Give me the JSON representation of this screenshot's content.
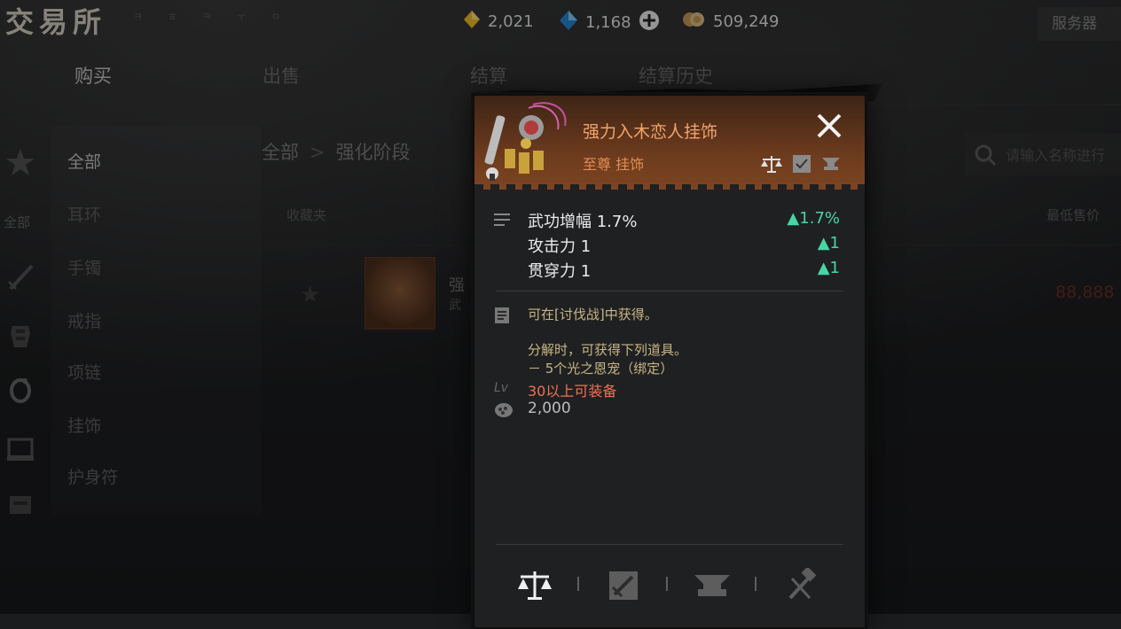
{
  "app": {
    "title": "交易所",
    "title_deco": "ㅋ ㅎ ㅋ ㅜ ㅇ"
  },
  "currencies": [
    {
      "icon": "gold-diamond-icon",
      "value": "2,021",
      "color": "#f3c12c"
    },
    {
      "icon": "blue-diamond-icon",
      "value": "1,168",
      "color": "#3aa0f2"
    },
    {
      "icon": "coin-icon",
      "value": "509,249",
      "color": "#d9b478"
    }
  ],
  "server_label": "服务器",
  "tabs": [
    {
      "label": "购买",
      "active": true
    },
    {
      "label": "出售",
      "active": false
    },
    {
      "label": "结算",
      "active": false
    },
    {
      "label": "结算历史",
      "active": false
    }
  ],
  "rail": {
    "label": "全部"
  },
  "categories": [
    {
      "label": "全部",
      "active": true
    },
    {
      "label": "耳环"
    },
    {
      "label": "手镯"
    },
    {
      "label": "戒指"
    },
    {
      "label": "项链"
    },
    {
      "label": "挂饰"
    },
    {
      "label": "护身符"
    }
  ],
  "breadcrumb": {
    "root": "全部",
    "sep": ">",
    "current": "强化阶段"
  },
  "search": {
    "placeholder": "请输入名称进行"
  },
  "columns": {
    "favorites": "收藏夹",
    "lowest_price": "最低售价"
  },
  "list": {
    "rows": [
      {
        "name": "强",
        "sub": "武",
        "price": "88,888"
      }
    ]
  },
  "tooltip": {
    "name": "强力入木恋人挂饰",
    "grade": "至尊 挂饰",
    "stats": [
      {
        "label": "武功增幅 1.7%",
        "delta": "▲1.7%"
      },
      {
        "label": "攻击力 1",
        "delta": "▲1"
      },
      {
        "label": "贯穿力 1",
        "delta": "▲1"
      }
    ],
    "source": "可在[讨伐战]中获得。",
    "disassemble_title": "分解时，可获得下列道具。",
    "disassemble_item": "－ 5个光之恩宠（绑定）",
    "level_req": "30以上可装备",
    "price": "2,000",
    "bottom_icons": [
      "scale-icon",
      "sword-check-icon",
      "anvil-icon",
      "hammer-icon"
    ],
    "colors": {
      "name": "#f2a46a",
      "delta": "#46d6a4",
      "level_req": "#f07153",
      "info": "#c8b583"
    }
  }
}
